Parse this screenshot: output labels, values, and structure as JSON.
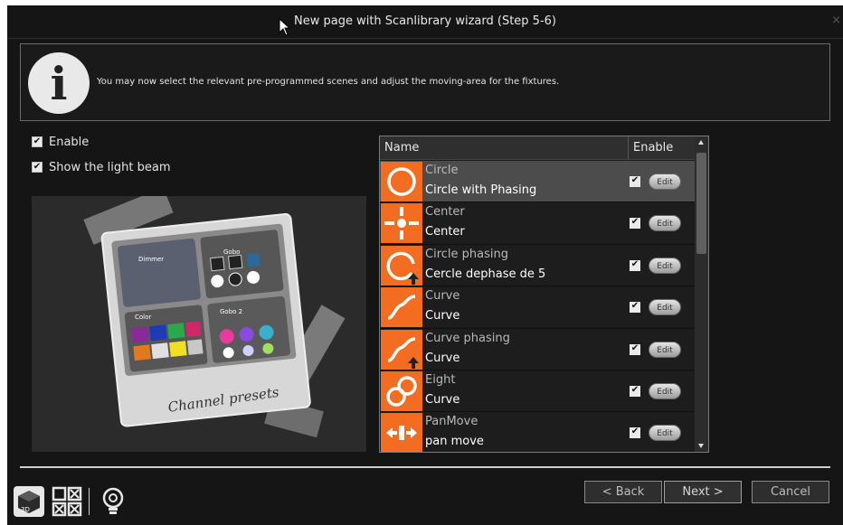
{
  "window": {
    "title": "New page with Scanlibrary wizard (Step 5-6)",
    "close_glyph": "×"
  },
  "info": {
    "icon_letter": "i",
    "message": "You may now select the relevant pre-programmed scenes and adjust the moving-area for the fixtures."
  },
  "options": {
    "enable_label": "Enable",
    "show_beam_label": "Show the light beam",
    "check_glyph": "✔"
  },
  "preview": {
    "caption": "Channel presets",
    "panel_labels": [
      "Dimmer",
      "Gobo",
      "Color",
      "Gobo 2"
    ]
  },
  "table": {
    "columns": {
      "name": "Name",
      "enable": "Enable"
    },
    "edit_label": "Edit",
    "rows": [
      {
        "icon": "circle-icon",
        "name": "Circle",
        "desc": "Circle with Phasing",
        "enabled": true,
        "selected": true
      },
      {
        "icon": "center-icon",
        "name": "Center",
        "desc": "Center",
        "enabled": true,
        "selected": false
      },
      {
        "icon": "circle-phasing-icon",
        "name": "Circle phasing",
        "desc": "Cercle dephase de 5",
        "enabled": true,
        "selected": false
      },
      {
        "icon": "curve-icon",
        "name": "Curve",
        "desc": "Curve",
        "enabled": true,
        "selected": false
      },
      {
        "icon": "curve-phasing-icon",
        "name": "Curve phasing",
        "desc": "Curve",
        "enabled": true,
        "selected": false
      },
      {
        "icon": "eight-icon",
        "name": "Eight",
        "desc": "Curve",
        "enabled": true,
        "selected": false
      },
      {
        "icon": "pan-move-icon",
        "name": "PanMove",
        "desc": "pan move",
        "enabled": true,
        "selected": false
      }
    ]
  },
  "buttons": {
    "back": "< Back",
    "next": "Next >",
    "cancel": "Cancel"
  },
  "colors": {
    "accent_orange": "#f26d21",
    "background": "#151515"
  }
}
